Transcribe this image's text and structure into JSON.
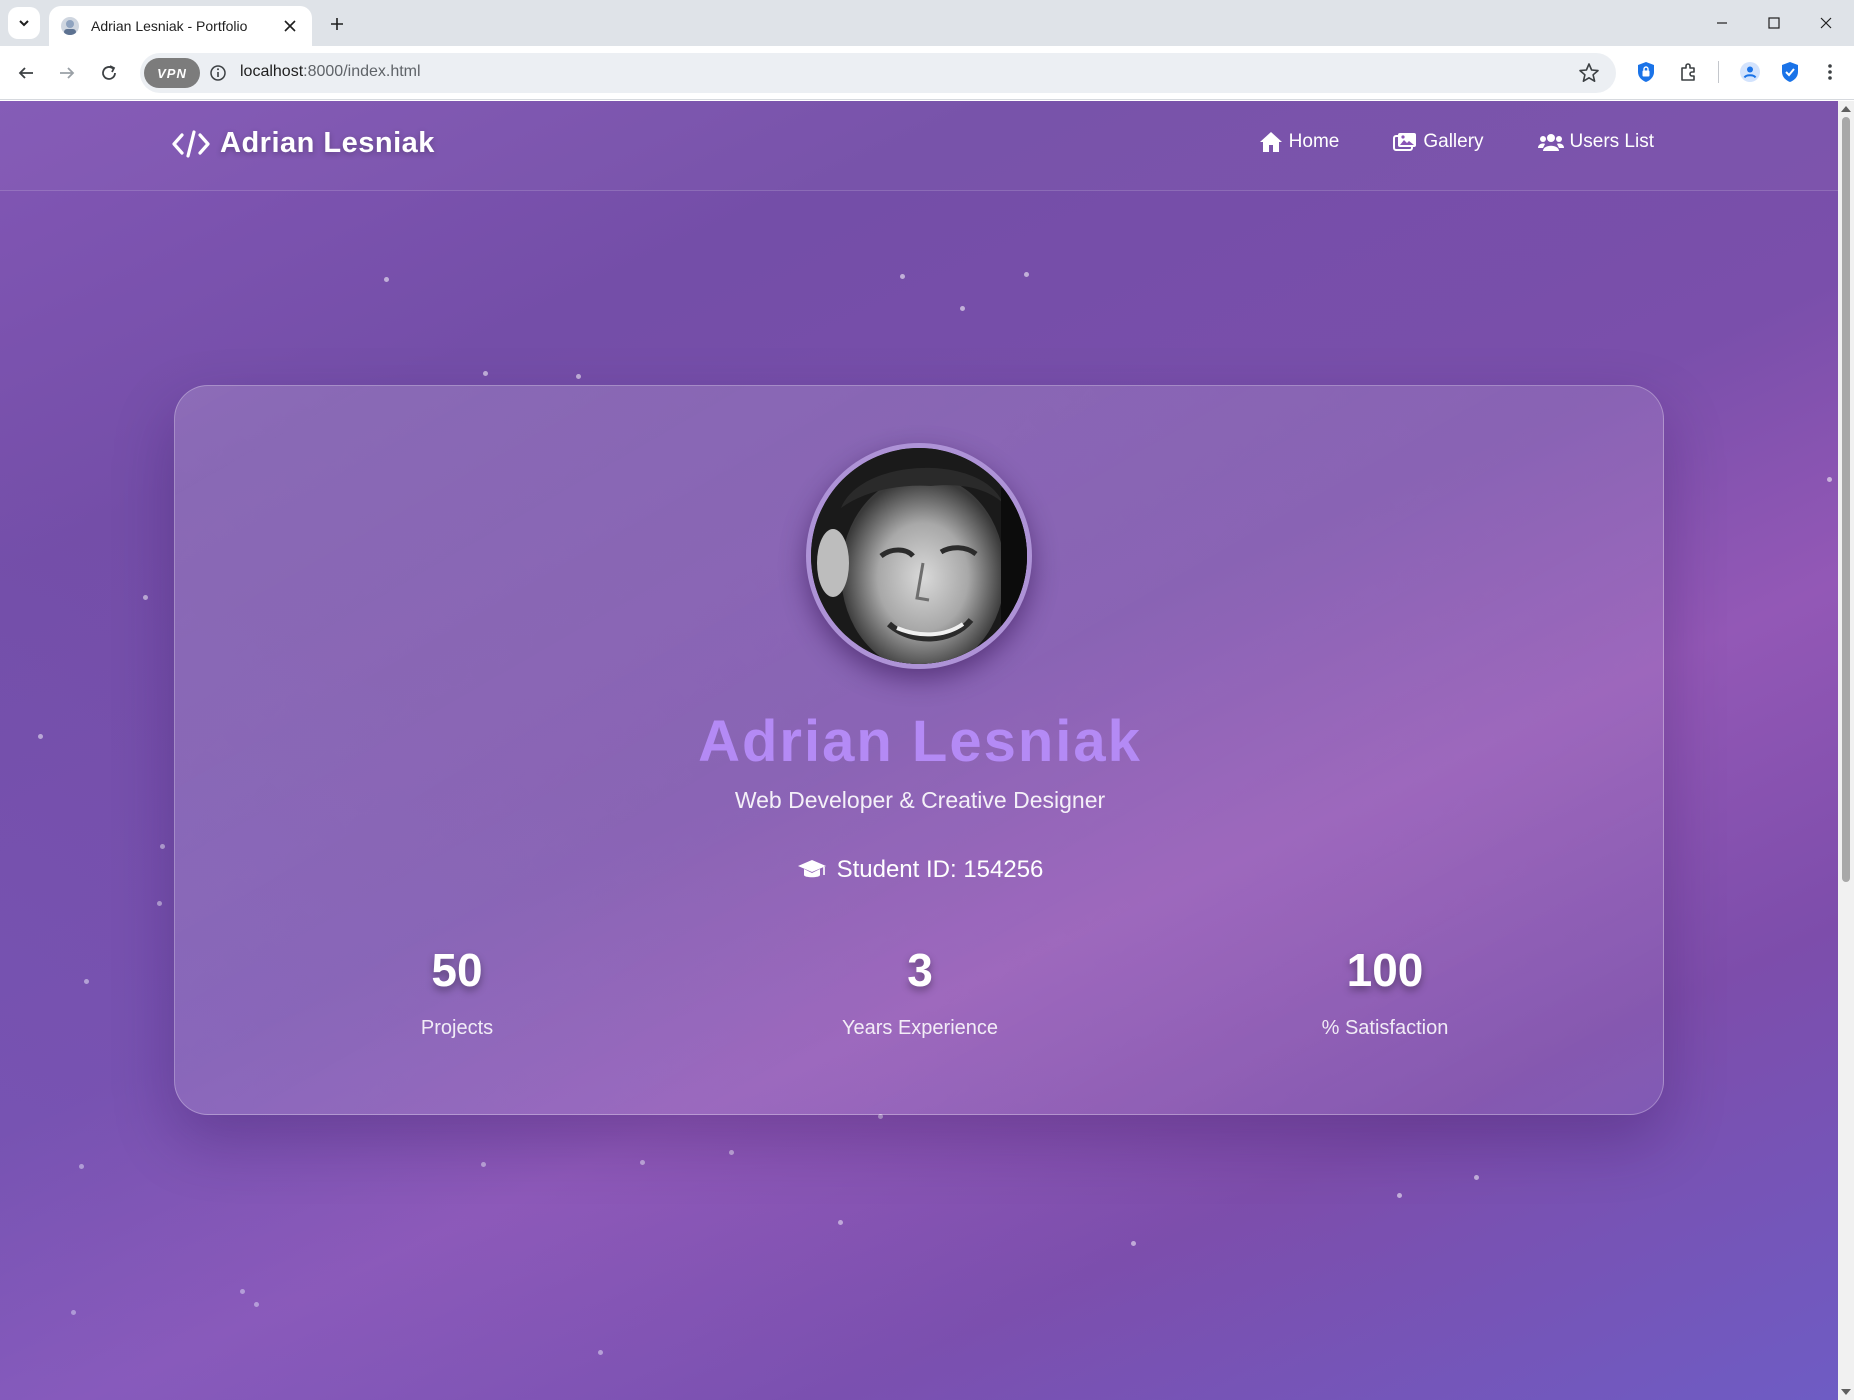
{
  "browser": {
    "tab_title": "Adrian Lesniak - Portfolio",
    "url_host": "localhost",
    "url_rest": ":8000/index.html",
    "vpn_label": "VPN"
  },
  "nav": {
    "brand": "Adrian Lesniak",
    "links": [
      {
        "label": "Home",
        "icon": "home-icon"
      },
      {
        "label": "Gallery",
        "icon": "images-icon"
      },
      {
        "label": "Users List",
        "icon": "users-icon"
      }
    ]
  },
  "hero": {
    "name": "Adrian Lesniak",
    "subtitle": "Web Developer & Creative Designer",
    "student_id": "Student ID: 154256"
  },
  "stats": [
    {
      "value": "50",
      "label": "Projects"
    },
    {
      "value": "3",
      "label": "Years Experience"
    },
    {
      "value": "100",
      "label": "% Satisfaction"
    }
  ],
  "colors": {
    "accent_name": "#b48af5",
    "background_start": "#8257b5",
    "background_end": "#6e5cc4"
  }
}
